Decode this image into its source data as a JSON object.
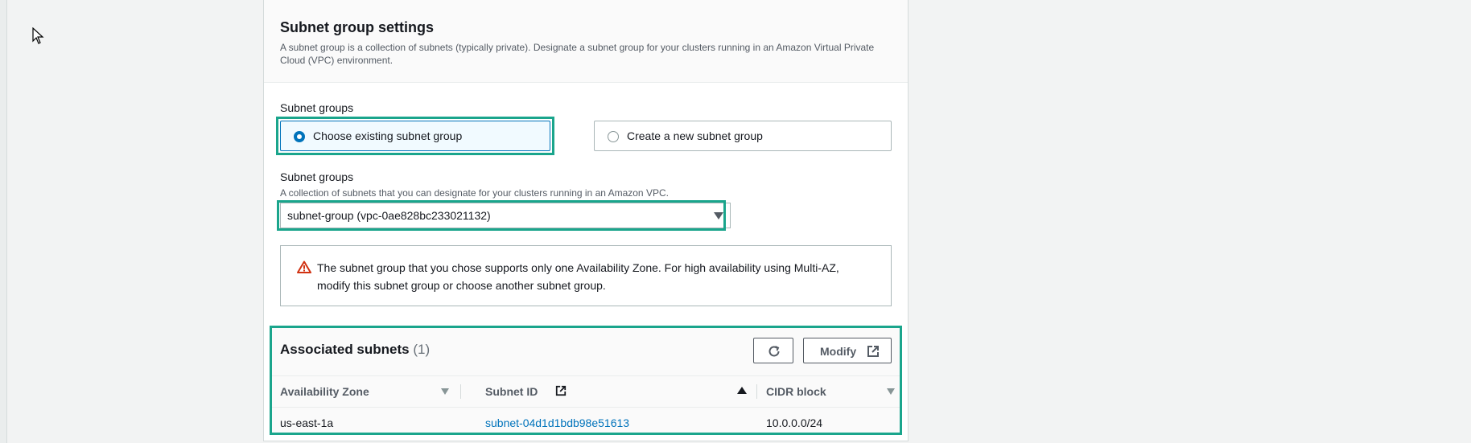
{
  "panel": {
    "title": "Subnet group settings",
    "description": "A subnet group is a collection of subnets (typically private). Designate a subnet group for your clusters running in an Amazon Virtual Private Cloud (VPC) environment."
  },
  "subnet_choice": {
    "label": "Subnet groups",
    "options": [
      {
        "label": "Choose existing subnet group",
        "selected": true
      },
      {
        "label": "Create a new subnet group",
        "selected": false
      }
    ]
  },
  "subnet_select": {
    "label": "Subnet groups",
    "description": "A collection of subnets that you can designate for your clusters running in an Amazon VPC.",
    "value": "subnet-group (vpc-0ae828bc233021132)"
  },
  "alert": {
    "icon": "warning-icon",
    "text": "The subnet group that you chose supports only one Availability Zone. For high availability using Multi-AZ, modify this subnet group or choose another subnet group."
  },
  "associated_subnets": {
    "title": "Associated subnets",
    "count": "(1)",
    "refresh_icon": "refresh-icon",
    "modify_label": "Modify",
    "columns": [
      "Availability Zone",
      "Subnet ID",
      "CIDR block"
    ],
    "rows": [
      {
        "availability_zone": "us-east-1a",
        "subnet_id": "subnet-04d1d1bdb98e51613",
        "cidr_block": "10.0.0.0/24"
      }
    ]
  },
  "colors": {
    "accent": "#0073bb",
    "focus": "#1aa58c",
    "warning": "#d13212"
  }
}
